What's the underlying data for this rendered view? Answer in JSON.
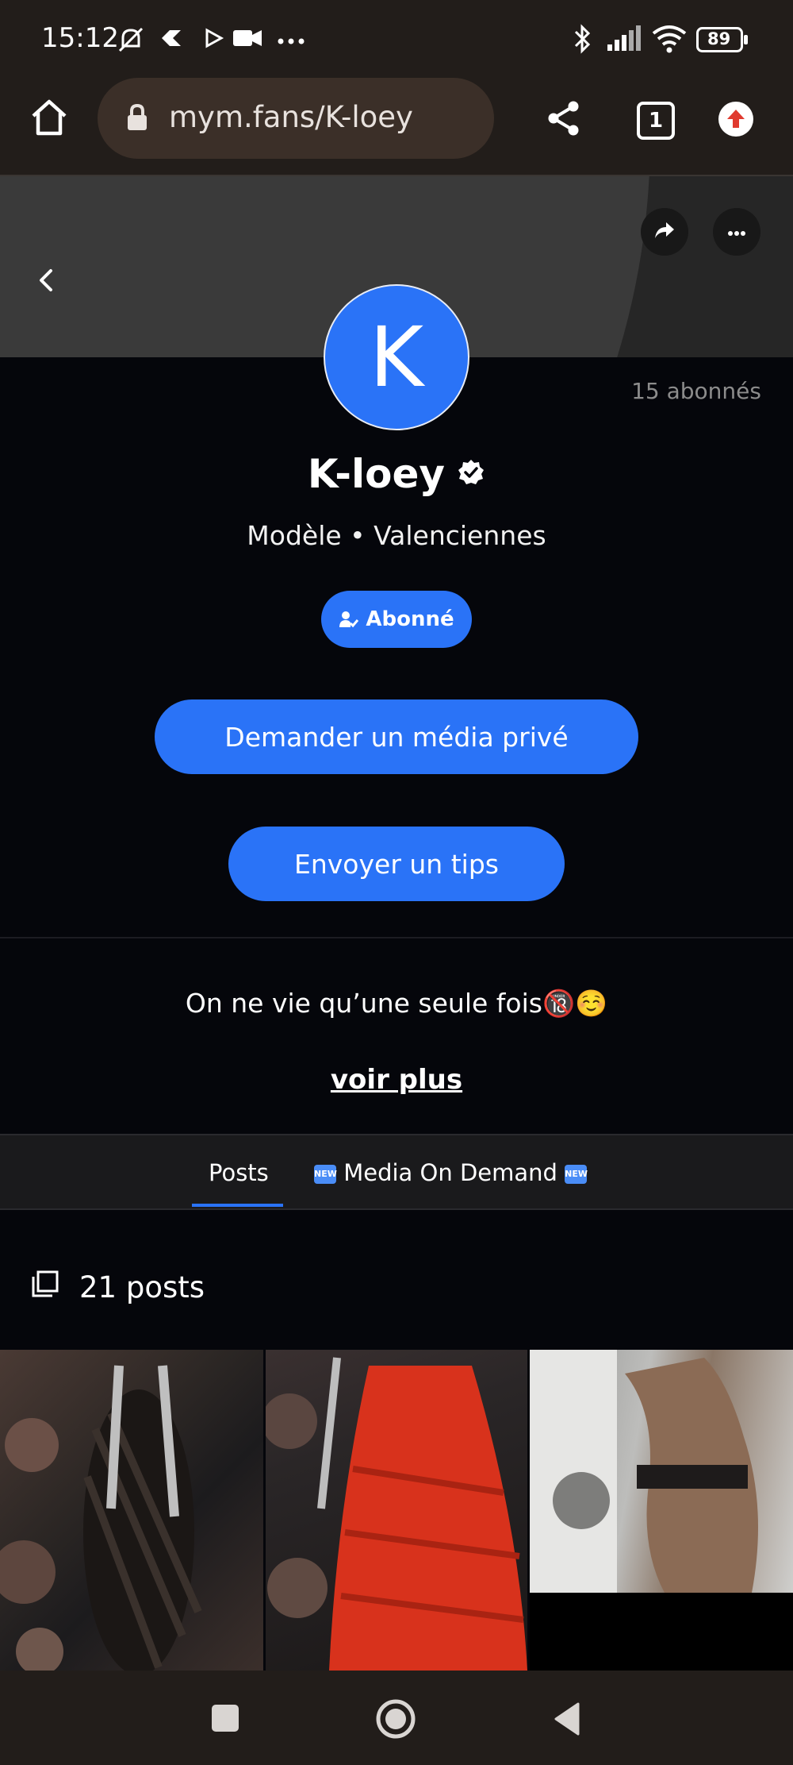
{
  "status_bar": {
    "time": "15:12",
    "battery": "89"
  },
  "browser": {
    "url": "mym.fans/K-loey",
    "tab_count": "1"
  },
  "profile": {
    "avatar_letter": "K",
    "followers": "15 abonnés",
    "name": "K-loey",
    "subtitle": "Modèle • Valenciennes",
    "subscribed_label": "Abonné",
    "request_media_label": "Demander un média privé",
    "send_tips_label": "Envoyer un tips",
    "bio": "On ne vie qu’une seule fois🔞☺️",
    "see_more": "voir plus"
  },
  "tabs": [
    {
      "label": "Posts",
      "active": true
    },
    {
      "label": "Media On Demand",
      "active": false
    }
  ],
  "posts": {
    "count_label": "21 posts"
  },
  "colors": {
    "accent": "#2a73f7",
    "background": "#05060b"
  }
}
